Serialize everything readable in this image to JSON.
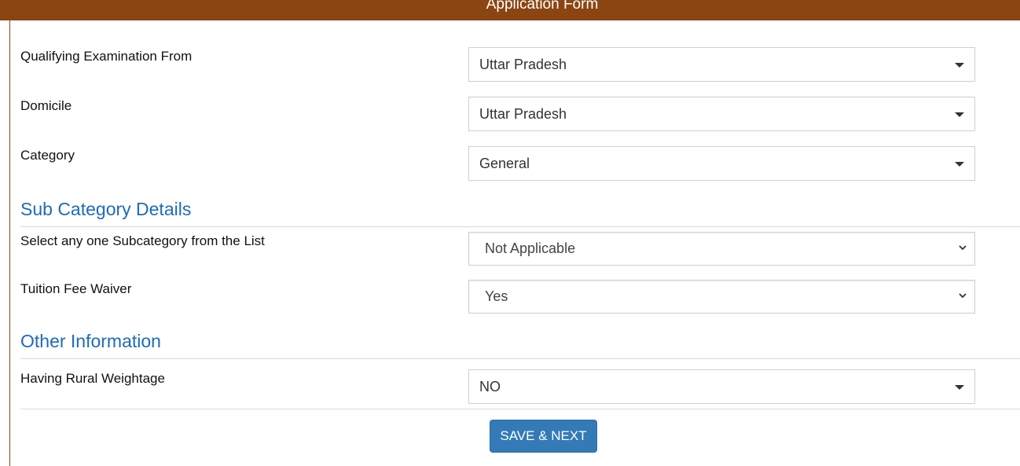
{
  "header": {
    "title": "Application Form"
  },
  "fields": {
    "qualifying": {
      "label": "Qualifying Examination From",
      "value": "Uttar Pradesh"
    },
    "domicile": {
      "label": "Domicile",
      "value": "Uttar Pradesh"
    },
    "category": {
      "label": "Category",
      "value": "General"
    }
  },
  "sub_category": {
    "title": "Sub Category Details",
    "subcategory": {
      "label": "Select any one Subcategory from the List",
      "value": "Not Applicable"
    },
    "tuition": {
      "label": "Tuition Fee Waiver",
      "value": "Yes"
    }
  },
  "other_info": {
    "title": "Other Information",
    "rural": {
      "label": "Having Rural Weightage",
      "value": "NO"
    }
  },
  "actions": {
    "save_next_label": "SAVE & NEXT"
  },
  "colors": {
    "header_bg": "#8b4513",
    "section_title": "#1e6bb8",
    "button_bg": "#337ab7"
  },
  "icons": {
    "select_caret": "caret-down-icon",
    "native_select": "chevron-down-icon"
  }
}
